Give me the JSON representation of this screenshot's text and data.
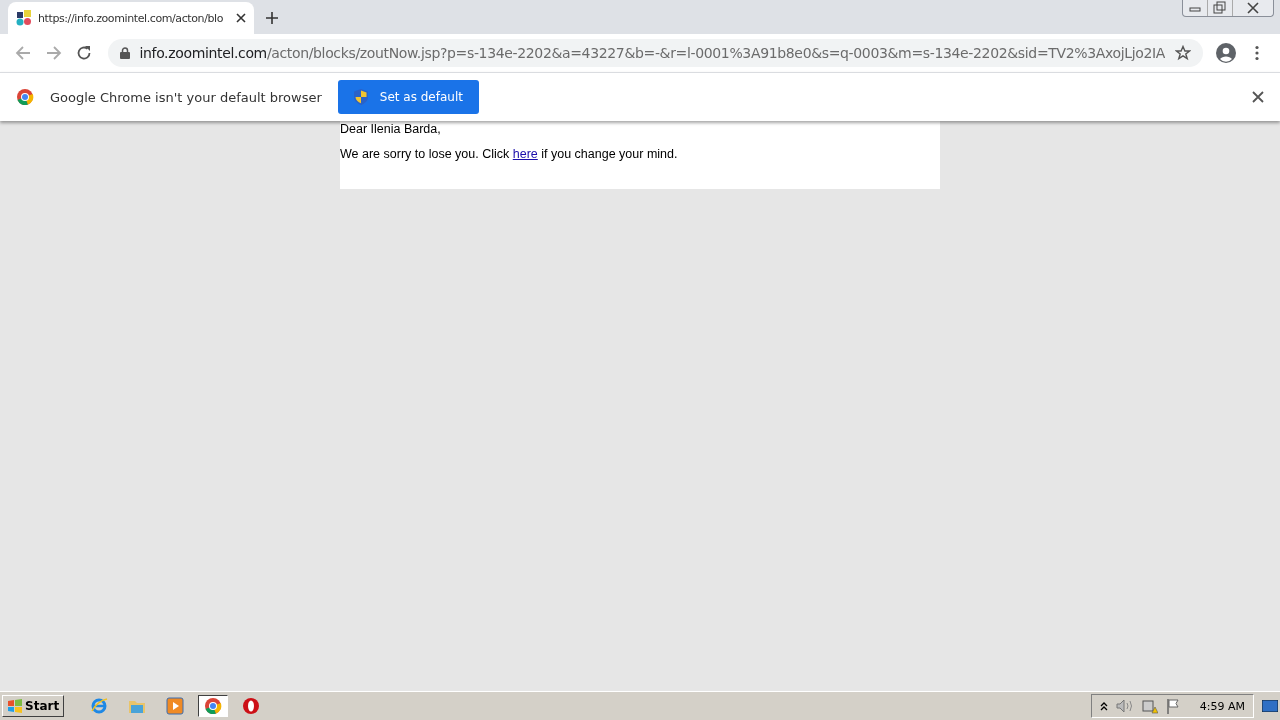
{
  "tab": {
    "title": "https://info.zoomintel.com/acton/blo",
    "selected": true
  },
  "address": {
    "host": "info.zoomintel.com",
    "path": "/acton/blocks/zoutNow.jsp?p=s-134e-2202&a=43227&b=-&r=l-0001%3A91b8e0&s=q-0003&m=s-134e-2202&sid=TV2%3AxojLjo2IA"
  },
  "infobar": {
    "message": "Google Chrome isn't your default browser",
    "button": "Set as default"
  },
  "email": {
    "greeting": "Dear Ilenia Barda,",
    "before_link": "We are sorry to lose you. Click",
    "link": "here",
    "after_link": "if you change your mind."
  },
  "taskbar": {
    "start": "Start",
    "apps": [
      {
        "kind": "ie",
        "selected": false
      },
      {
        "kind": "folder",
        "selected": false
      },
      {
        "kind": "media",
        "selected": false
      },
      {
        "kind": "chrome",
        "selected": true
      },
      {
        "kind": "opera",
        "selected": false
      }
    ],
    "clock": "4:59 AM"
  }
}
